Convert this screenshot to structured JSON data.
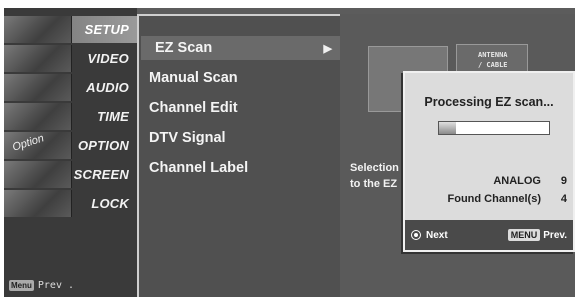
{
  "left_menu": {
    "items": [
      {
        "label": "SETUP",
        "active": true
      },
      {
        "label": "VIDEO",
        "active": false
      },
      {
        "label": "AUDIO",
        "active": false
      },
      {
        "label": "TIME",
        "active": false
      },
      {
        "label": "OPTION",
        "active": false
      },
      {
        "label": "SCREEN",
        "active": false
      },
      {
        "label": "LOCK",
        "active": false
      }
    ],
    "option_thumb_text": "Option",
    "menu_key_label": "Menu",
    "prev_label": "Prev ."
  },
  "submenu": {
    "items": [
      {
        "label": "EZ Scan",
        "active": true,
        "arrow": "▶"
      },
      {
        "label": "Manual Scan"
      },
      {
        "label": "Channel Edit"
      },
      {
        "label": "DTV Signal"
      },
      {
        "label": "Channel Label"
      }
    ]
  },
  "right_panel": {
    "antenna_line1": "ANTENNA",
    "antenna_line2": "/ CABLE",
    "desc_line1": "Selection",
    "desc_line2": "to the EZ"
  },
  "dialog": {
    "title": "Processing EZ scan...",
    "progress_fraction": 0.15,
    "analog_label": "ANALOG",
    "analog_value": "9",
    "found_label": "Found Channel(s)",
    "found_value": "4",
    "next_label": "Next",
    "menu_key_label": "MENU",
    "prev_label": "Prev."
  }
}
